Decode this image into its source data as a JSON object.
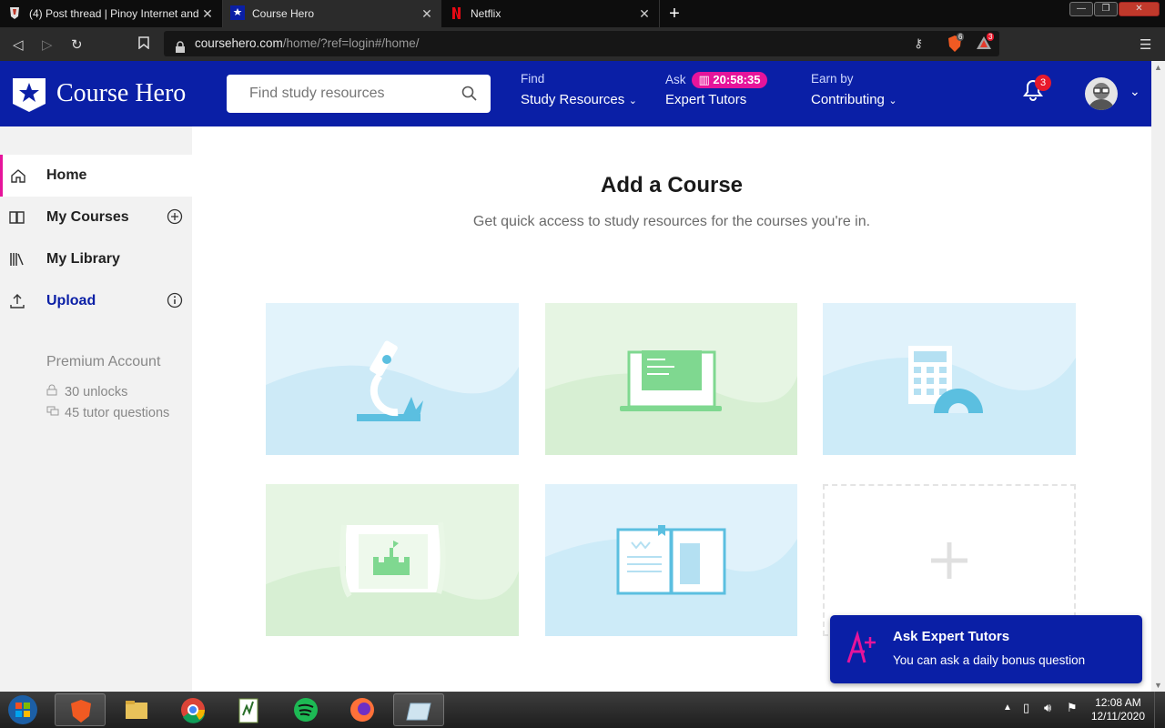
{
  "browser": {
    "tabs": [
      {
        "title": "(4) Post thread | Pinoy Internet and",
        "active": false
      },
      {
        "title": "Course Hero",
        "active": true
      },
      {
        "title": "Netflix",
        "active": false
      }
    ],
    "url_domain": "coursehero.com",
    "url_path": "/home/?ref=login#/home/",
    "brave_shield_count": "6",
    "rewards_count": "3"
  },
  "header": {
    "logo_text": "Course Hero",
    "search_placeholder": "Find study resources",
    "menus": [
      {
        "small": "Find",
        "big": "Study Resources"
      },
      {
        "small": "Ask",
        "big": "Expert Tutors",
        "timer": "20:58:35"
      },
      {
        "small": "Earn by",
        "big": "Contributing"
      }
    ],
    "notification_count": "3"
  },
  "sidebar": {
    "items": [
      {
        "label": "Home",
        "icon": "home-icon"
      },
      {
        "label": "My Courses",
        "icon": "book-icon"
      },
      {
        "label": "My Library",
        "icon": "library-icon"
      },
      {
        "label": "Upload",
        "icon": "upload-icon"
      }
    ],
    "premium_title": "Premium Account",
    "unlocks": "30 unlocks",
    "tutor_questions": "45 tutor questions"
  },
  "main": {
    "title": "Add a Course",
    "subtitle": "Get quick access to study resources for the courses you're in."
  },
  "toast": {
    "title": "Ask Expert Tutors",
    "text": "You can ask a daily bonus question"
  },
  "taskbar": {
    "time": "12:08 AM",
    "date": "12/11/2020"
  },
  "colors": {
    "brand_blue": "#0a1fa6",
    "accent_pink": "#e6149b"
  }
}
